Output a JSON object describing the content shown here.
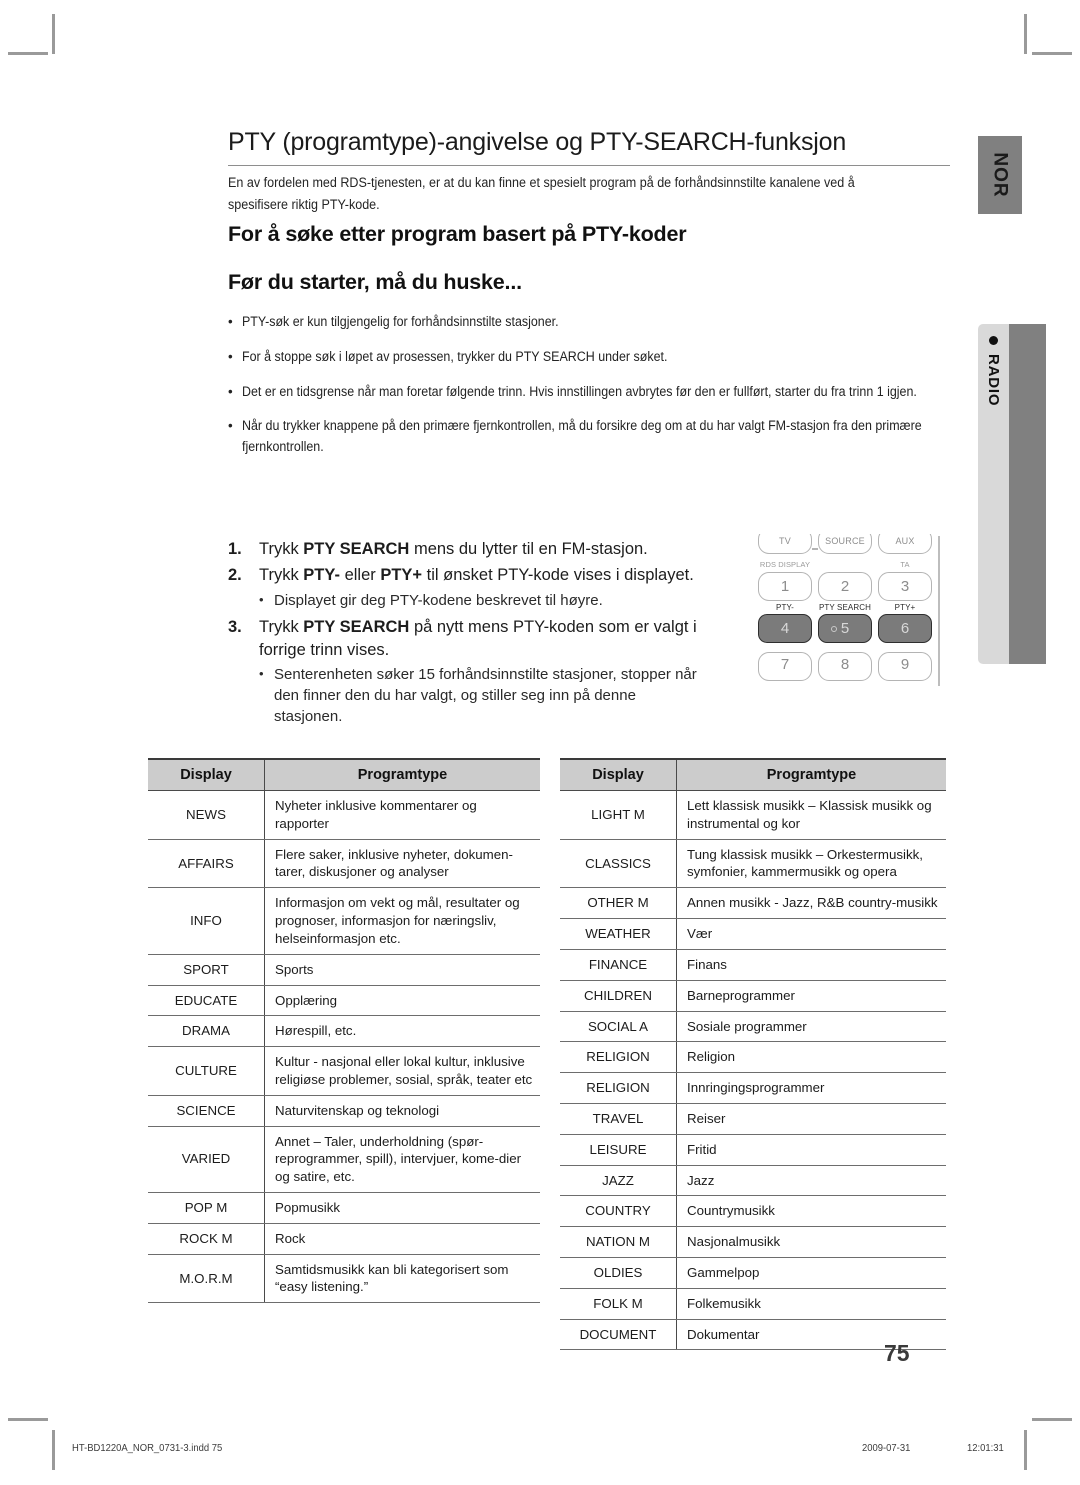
{
  "document": {
    "title": "PTY (programtype)-angivelse og PTY-SEARCH-funksjon",
    "intro": "En av fordelen med RDS-tjenesten, er at du kan finne et spesielt program på de forhåndsinnstilte kanalene ved å spesifisere riktig PTY-kode.",
    "subhead_1": "For å søke etter program basert på PTY-koder",
    "subhead_2": "Før du starter, må du huske...",
    "page_number": "75"
  },
  "notes": {
    "bullet_glyph": "•",
    "items": [
      "PTY-søk er kun tilgjengelig for forhåndsinnstilte stasjoner.",
      "For å stoppe søk i løpet av prosessen, trykker du PTY SEARCH under søket.",
      "Det er en tidsgrense når man foretar følgende trinn. Hvis innstillingen avbrytes før den er fullført, starter du fra trinn 1 igjen.",
      "Når du trykker knappene på den primære fjernkontrollen, må du forsikre deg om at du har valgt FM-stasjon fra den primære fjernkontrollen."
    ]
  },
  "steps": {
    "bullet_glyph": "•",
    "items": [
      {
        "number": "1.",
        "parts": [
          {
            "text": "Trykk ",
            "bold": false
          },
          {
            "text": "PTY SEARCH",
            "bold": true
          },
          {
            "text": " mens du lytter til en FM-stasjon.",
            "bold": false
          }
        ],
        "sub": []
      },
      {
        "number": "2.",
        "parts": [
          {
            "text": "Trykk ",
            "bold": false
          },
          {
            "text": "PTY-",
            "bold": true
          },
          {
            "text": " eller ",
            "bold": false
          },
          {
            "text": "PTY+",
            "bold": true
          },
          {
            "text": " til ønsket PTY-kode vises i displayet.",
            "bold": false
          }
        ],
        "sub": [
          "Displayet gir deg PTY-kodene beskrevet til høyre."
        ]
      },
      {
        "number": "3.",
        "parts": [
          {
            "text": "Trykk ",
            "bold": false
          },
          {
            "text": "PTY SEARCH",
            "bold": true
          },
          {
            "text": " på nytt mens PTY-koden som er valgt i forrige trinn vises.",
            "bold": false
          }
        ],
        "sub": [
          "Senterenheten søker 15 forhåndsinnstilte stasjoner, stopper når den finner den du har valgt, og stiller seg inn på denne stasjonen."
        ]
      }
    ]
  },
  "remote": {
    "top_buttons": [
      "TV",
      "SOURCE",
      "AUX"
    ],
    "labels_row1": [
      "RDS DISPLAY",
      "",
      "TA"
    ],
    "numbers_row1": [
      "1",
      "2",
      "3"
    ],
    "labels_row2": [
      "PTY-",
      "PTY SEARCH",
      "PTY+"
    ],
    "numbers_row2": [
      "4",
      "5",
      "6"
    ],
    "numbers_row3": [
      "7",
      "8",
      "9"
    ]
  },
  "side_tabs": {
    "language": "NOR",
    "section": "RADIO",
    "section_bullet": "●"
  },
  "tables": {
    "headers": [
      "Display",
      "Programtype"
    ],
    "left_rows": [
      [
        "NEWS",
        "Nyheter inklusive kommentarer og rapporter"
      ],
      [
        "AFFAIRS",
        "Flere saker, inklusive nyheter, dokumen-tarer, diskusjoner og analyser"
      ],
      [
        "INFO",
        "Informasjon om vekt og mål, resultater og prognoser, informasjon for næringsliv, helseinformasjon etc."
      ],
      [
        "SPORT",
        "Sports"
      ],
      [
        "EDUCATE",
        "Opplæring"
      ],
      [
        "DRAMA",
        "Hørespill, etc."
      ],
      [
        "CULTURE",
        "Kultur - nasjonal eller lokal kultur, inklusive religiøse problemer, sosial, språk, teater etc"
      ],
      [
        "SCIENCE",
        "Naturvitenskap og teknologi"
      ],
      [
        "VARIED",
        "Annet – Taler, underholdning (spør-reprogrammer, spill), intervjuer, kome-dier og satire, etc."
      ],
      [
        "POP M",
        "Popmusikk"
      ],
      [
        "ROCK M",
        "Rock"
      ],
      [
        "M.O.R.M",
        "Samtidsmusikk kan bli kategorisert som “easy listening.”"
      ]
    ],
    "right_rows": [
      [
        "LIGHT M",
        "Lett klassisk musikk – Klassisk musikk og instrumental og kor"
      ],
      [
        "CLASSICS",
        "Tung klassisk musikk – Orkestermusikk, symfonier, kammermusikk og opera"
      ],
      [
        "OTHER M",
        "Annen musikk - Jazz, R&B country-musikk"
      ],
      [
        "WEATHER",
        "Vær"
      ],
      [
        "FINANCE",
        "Finans"
      ],
      [
        "CHILDREN",
        "Barneprogrammer"
      ],
      [
        "SOCIAL A",
        "Sosiale programmer"
      ],
      [
        "RELIGION",
        "Religion"
      ],
      [
        "RELIGION",
        "Innringingsprogrammer"
      ],
      [
        "TRAVEL",
        "Reiser"
      ],
      [
        "LEISURE",
        "Fritid"
      ],
      [
        "JAZZ",
        "Jazz"
      ],
      [
        "COUNTRY",
        "Countrymusikk"
      ],
      [
        "NATION M",
        "Nasjonalmusikk"
      ],
      [
        "OLDIES",
        "Gammelpop"
      ],
      [
        "FOLK M",
        "Folkemusikk"
      ],
      [
        "DOCUMENT",
        "Dokumentar"
      ]
    ]
  },
  "footer": {
    "file": "HT-BD1220A_NOR_0731-3.indd   75",
    "date": "2009-07-31",
    "time": "12:01:31"
  }
}
